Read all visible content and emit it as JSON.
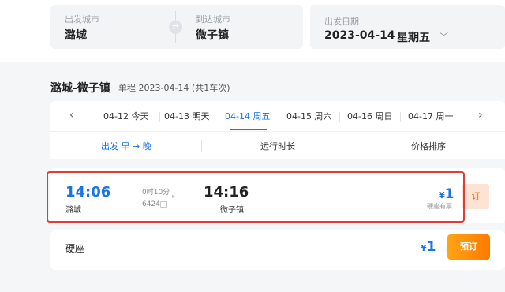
{
  "search": {
    "from_label": "出发城市",
    "from_city": "潞城",
    "to_label": "到达城市",
    "to_city": "微子镇",
    "swap_icon": "⇄",
    "date_label": "出发日期",
    "date_value": "2023-04-14",
    "weekday": "星期五",
    "chevron_icon": "﹀"
  },
  "route": {
    "title": "潞城-微子镇",
    "subtitle": "单程 2023-04-14 (共1车次)"
  },
  "date_strip": {
    "prev_icon": "‹",
    "next_icon": "›",
    "tabs": [
      {
        "label": "04-12 今天"
      },
      {
        "label": "04-13 明天"
      },
      {
        "label": "04-14 周五"
      },
      {
        "label": "04-15 周六"
      },
      {
        "label": "04-16 周日"
      },
      {
        "label": "04-17 周一"
      }
    ],
    "active_index": 2
  },
  "sort_bar": {
    "items": [
      {
        "label": "出发  早 → 晚"
      },
      {
        "label": "运行时长"
      },
      {
        "label": "价格排序"
      }
    ],
    "active_index": 0
  },
  "train": {
    "depart_time": "14:06",
    "depart_station": "潞城",
    "duration": "0时10分",
    "train_no": "6424",
    "arrive_time": "14:16",
    "arrive_station": "微子镇",
    "currency": "¥",
    "price": "1",
    "seat_status": "硬座有票",
    "book_label": "订"
  },
  "seat": {
    "name": "硬座",
    "currency": "¥",
    "price": "1",
    "book_label": "预订"
  },
  "colors": {
    "accent": "#1a73e8",
    "highlight": "#e53935",
    "book_orange": "#ff7a00"
  }
}
